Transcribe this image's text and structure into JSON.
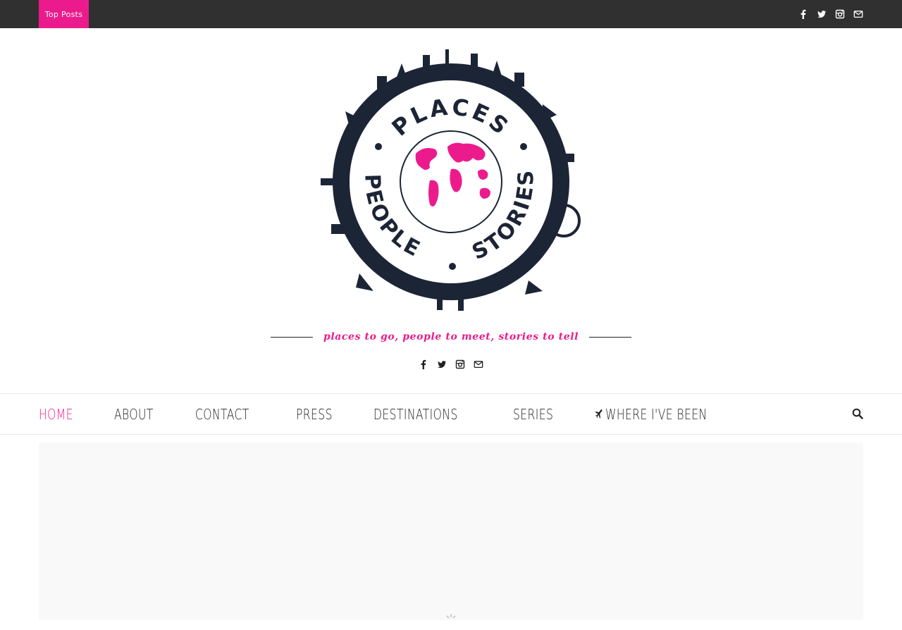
{
  "topbar": {
    "top_posts_label": "Top Posts",
    "social": [
      "facebook-icon",
      "twitter-icon",
      "instagram-icon",
      "envelope-icon"
    ]
  },
  "logo": {
    "top_word": "PLACES",
    "left_word": "PEOPLE",
    "right_word": "STORIES"
  },
  "tagline": "places to go, people to meet, stories to tell",
  "nav": {
    "items": [
      {
        "label": "HOME",
        "active": true
      },
      {
        "label": "ABOUT"
      },
      {
        "label": "CONTACT"
      },
      {
        "label": "PRESS"
      },
      {
        "label": "DESTINATIONS"
      },
      {
        "label": "SERIES"
      },
      {
        "label": "WHERE I'VE BEEN",
        "icon": "plane-icon"
      }
    ],
    "search_icon": "search-icon"
  },
  "colors": {
    "accent": "#ec1b8d",
    "topbar": "#303030",
    "logo_dark": "#1c2536"
  }
}
